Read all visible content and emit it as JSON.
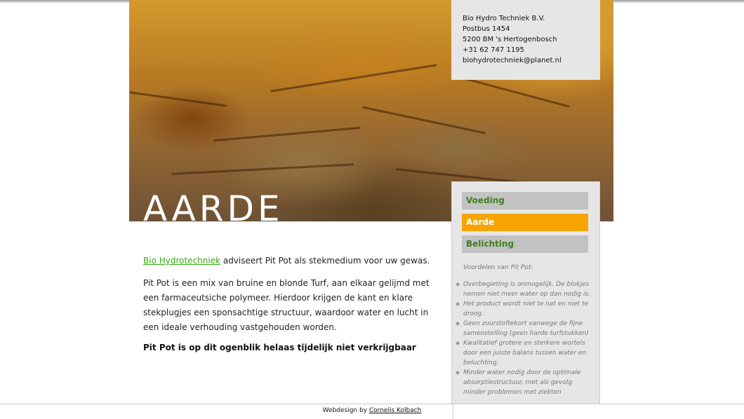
{
  "header": {
    "title": "AARDE"
  },
  "address": {
    "company": "Bio Hydro Techniek B.V.",
    "postbox": "Postbus 1454",
    "city": "5200 BM 's Hertogenbosch",
    "phone": "+31 62 747 1195",
    "email": "biohydrotechniek@planet.nl"
  },
  "nav": {
    "items": [
      {
        "label": "Voeding",
        "state": "inactive"
      },
      {
        "label": "Aarde",
        "state": "active"
      },
      {
        "label": "Belichting",
        "state": "inactive"
      }
    ]
  },
  "sidebar": {
    "heading": "Voordelen van Pit Pot:",
    "benefits": [
      "Overbegieting is onmogelijk. De blokjes nemen niet meer water op dan nodig is.",
      "Het product wordt niet te nat en niet te droog.",
      "Geen zuurstoftekort vanwege de fijne samenstelling (geen harde turfstukken)",
      "Kwalitatief grotere en sterkere wortels door een juiste balans tussen water en beluchting.",
      "Minder water nodig door de optimale absorptiestructuur, met als gevolg minder problemen met ziekten"
    ]
  },
  "main": {
    "intro_link": "Bio Hydrotechniek",
    "intro_rest": " adviseert Pit Pot als stekmedium voor uw gewas.",
    "paragraph": "Pit Pot is een mix van bruine en blonde Turf, aan elkaar gelijmd met een farmaceutsiche polymeer. Hierdoor krijgen de kant en klare stekplugjes een sponsachtige structuur, waardoor water en lucht in een ideale verhouding vastgehouden worden.",
    "notice": "Pit Pot is op dit ogenblik helaas tijdelijk niet verkrijgbaar"
  },
  "footer": {
    "prefix": "Webdesign by ",
    "link": "Cornelis Kolbach"
  },
  "colors": {
    "nav_active": "#f6a400",
    "nav_inactive": "#c2c2c2",
    "nav_text": "#3f7f1f",
    "link": "#33aa11",
    "panel": "#e6e6e6"
  }
}
